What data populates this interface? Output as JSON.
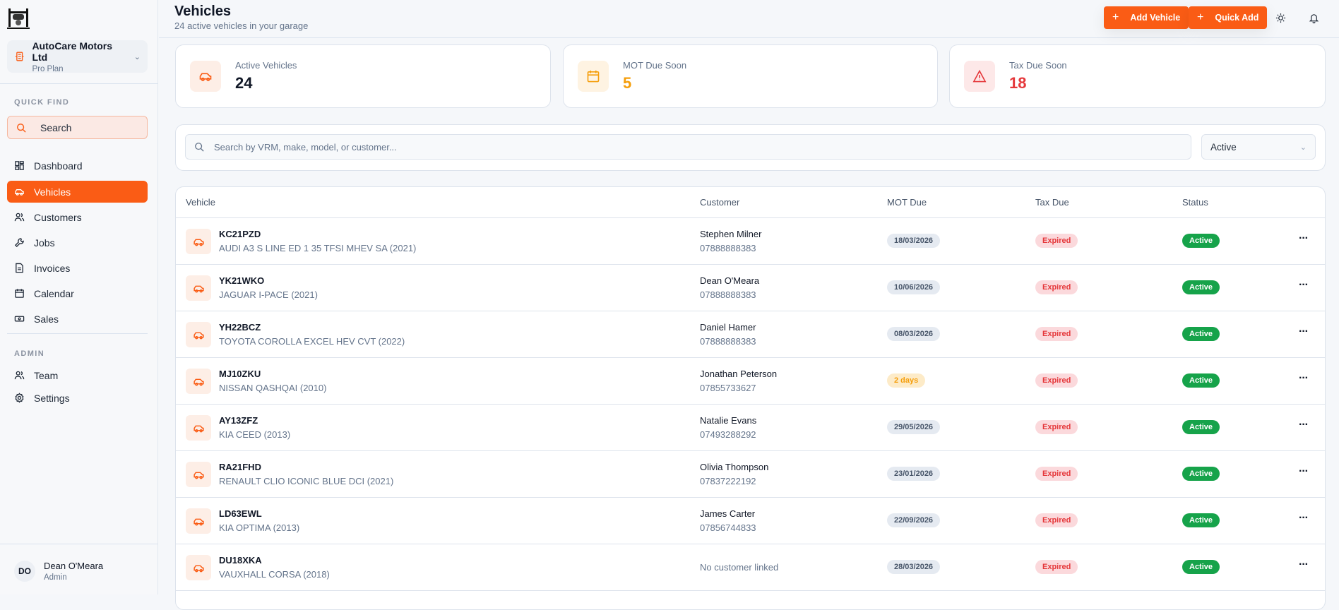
{
  "brand": {
    "company": "AutoCare Motors Ltd",
    "plan": "Pro Plan"
  },
  "sidebar": {
    "quick_find": "QUICK FIND",
    "search": "Search",
    "items": [
      {
        "label": "Dashboard",
        "icon": "grid-icon"
      },
      {
        "label": "Vehicles",
        "icon": "car-icon"
      },
      {
        "label": "Customers",
        "icon": "users-icon"
      },
      {
        "label": "Jobs",
        "icon": "wrench-icon"
      },
      {
        "label": "Invoices",
        "icon": "file-icon"
      },
      {
        "label": "Calendar",
        "icon": "calendar-icon"
      },
      {
        "label": "Sales",
        "icon": "cash-icon"
      }
    ],
    "admin": "ADMIN",
    "admin_items": [
      {
        "label": "Team"
      },
      {
        "label": "Settings"
      }
    ],
    "user": {
      "initials": "DO",
      "name": "Dean O'Meara",
      "role": "Admin"
    }
  },
  "header": {
    "title": "Vehicles",
    "subtitle": "24 active vehicles in your garage",
    "add_vehicle": "Add Vehicle",
    "quick_add": "Quick Add"
  },
  "stats": [
    {
      "label": "Active Vehicles",
      "value": "24",
      "color": "#111827"
    },
    {
      "label": "MOT Due Soon",
      "value": "5",
      "color": "#f59e0b"
    },
    {
      "label": "Tax Due Soon",
      "value": "18",
      "color": "#e5383b"
    }
  ],
  "filter": {
    "placeholder": "Search by VRM, make, model, or customer...",
    "status": "Active"
  },
  "table": {
    "headers": [
      "Vehicle",
      "Customer",
      "MOT Due",
      "Tax Due",
      "Status"
    ],
    "rows": [
      {
        "vrm": "KC21PZD",
        "model": "AUDI A3 S LINE ED 1 35 TFSI MHEV SA (2021)",
        "customer": "Stephen Milner",
        "phone": "07888888383",
        "mot": "18/03/2026",
        "tax": "Expired",
        "status": "Active"
      },
      {
        "vrm": "YK21WKO",
        "model": "JAGUAR I-PACE (2021)",
        "customer": "Dean O'Meara",
        "phone": "07888888383",
        "mot": "10/06/2026",
        "tax": "Expired",
        "status": "Active"
      },
      {
        "vrm": "YH22BCZ",
        "model": "TOYOTA COROLLA EXCEL HEV CVT (2022)",
        "customer": "Daniel Hamer",
        "phone": "07888888383",
        "mot": "08/03/2026",
        "tax": "Expired",
        "status": "Active"
      },
      {
        "vrm": "MJ10ZKU",
        "model": "NISSAN QASHQAI (2010)",
        "customer": "Jonathan Peterson",
        "phone": "07855733627",
        "mot": "2 days",
        "tax": "Expired",
        "status": "Active"
      },
      {
        "vrm": "AY13ZFZ",
        "model": "KIA CEED (2013)",
        "customer": "Natalie Evans",
        "phone": "07493288292",
        "mot": "29/05/2026",
        "tax": "Expired",
        "status": "Active"
      },
      {
        "vrm": "RA21FHD",
        "model": "RENAULT CLIO ICONIC BLUE DCI (2021)",
        "customer": "Olivia Thompson",
        "phone": "07837222192",
        "mot": "23/01/2026",
        "tax": "Expired",
        "status": "Active"
      },
      {
        "vrm": "LD63EWL",
        "model": "KIA OPTIMA (2013)",
        "customer": "James Carter",
        "phone": "07856744833",
        "mot": "22/09/2026",
        "tax": "Expired",
        "status": "Active"
      },
      {
        "vrm": "DU18XKA",
        "model": "VAUXHALL CORSA (2018)",
        "customer": "",
        "no_customer": "No customer linked",
        "phone": "",
        "mot": "28/03/2026",
        "tax": "Expired",
        "status": "Active"
      }
    ]
  }
}
